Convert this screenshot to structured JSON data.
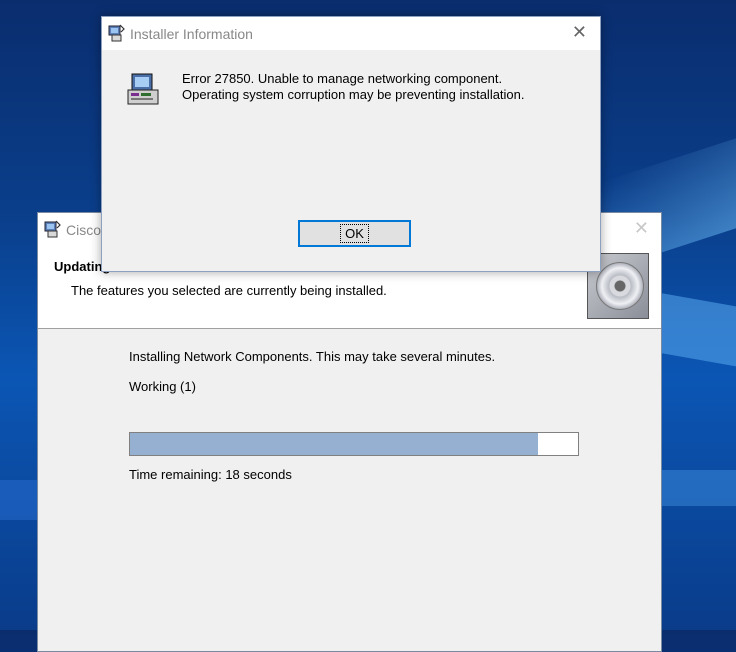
{
  "main_window": {
    "title": "Cisco",
    "header_title": "Updating",
    "header_subtitle": "The features you selected are currently being installed.",
    "status_text": "Installing Network Components. This may take several minutes.",
    "working_text": "Working  (1)",
    "progress_fraction": 0.91,
    "time_remaining": "Time remaining: 18 seconds",
    "close_icon": "close-icon",
    "header_image": "cd-disc-icon"
  },
  "dialog": {
    "title": "Installer Information",
    "message_line1": "Error 27850. Unable to manage networking component.",
    "message_line2": "Operating system corruption may be preventing installation.",
    "ok_label": "OK",
    "close_icon": "close-icon",
    "message_icon": "installer-computer-icon"
  },
  "colors": {
    "progress_fill": "#96b0d2",
    "focus_border": "#0078d7"
  }
}
